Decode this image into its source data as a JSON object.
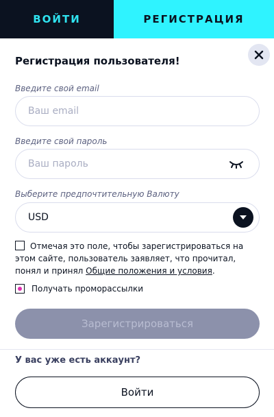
{
  "tabs": {
    "login": "ВОЙТИ",
    "register": "РЕГИСТРАЦИЯ"
  },
  "form": {
    "title": "Регистрация пользователя!",
    "email": {
      "label": "Введите свой email",
      "placeholder": "Ваш email"
    },
    "password": {
      "label": "Введите свой пароль",
      "placeholder": "Ваш пароль"
    },
    "currency": {
      "label": "Выберите предпочтительную Валюту",
      "selected": "USD"
    },
    "terms": {
      "text": "Отмечая это поле, чтобы зарегистрироваться на этом сайте, пользователь заявляет, что прочитал, понял и принял ",
      "link": "Общие положения и условия",
      "suffix": "."
    },
    "promo": {
      "label": "Получать промо­рассылки"
    },
    "submit_label": "Зарегистрироваться"
  },
  "footer": {
    "have_account": "У вас уже есть аккаунт?",
    "login_label": "Войти"
  },
  "colors": {
    "accent": "#2ff3ff",
    "dark": "#0b1220",
    "disabled_button": "#8c91ab",
    "promo_check": "#e02fb0"
  },
  "icons": {
    "close": "close-icon",
    "eye": "eye-closed-icon",
    "chevron": "chevron-down-icon"
  }
}
